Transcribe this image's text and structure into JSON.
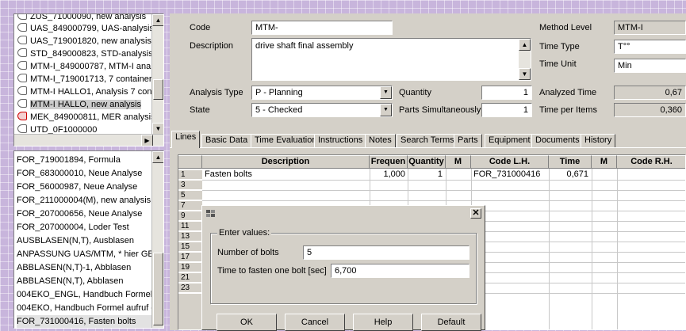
{
  "tree": {
    "items": [
      {
        "label": "ZUS_71000090, new analysis",
        "icon": "analysis-icon",
        "selected": false
      },
      {
        "label": "UAS_849000799, UAS-analysis",
        "icon": "analysis-icon",
        "selected": false
      },
      {
        "label": "UAS_719001820, new analysis",
        "icon": "analysis-icon",
        "selected": false
      },
      {
        "label": "STD_849000823, STD-analysis",
        "icon": "analysis-icon",
        "selected": false
      },
      {
        "label": "MTM-I_849000787, MTM-I analy",
        "icon": "analysis-icon",
        "selected": false
      },
      {
        "label": "MTM-I_719001713, 7 container",
        "icon": "analysis-icon",
        "selected": false
      },
      {
        "label": "MTM-I HALLO1, Analysis 7 con",
        "icon": "analysis-icon",
        "selected": false
      },
      {
        "label": "MTM-I HALLO, new analysis",
        "icon": "analysis-icon",
        "selected": true
      },
      {
        "label": "MEK_849000811, MER analysis",
        "icon": "analysis-red-icon",
        "selected": false
      },
      {
        "label": "UTD_0F1000000",
        "icon": "analysis-icon",
        "selected": false
      }
    ]
  },
  "formulas": {
    "items": [
      "FOR_719001894, Formula",
      "FOR_683000010, Neue Analyse",
      "FOR_56000987, Neue Analyse",
      "FOR_211000004(M), new analysis ar",
      "FOR_207000656, Neue Analyse",
      "FOR_207000004, Loder Test",
      "AUSBLASEN(N,T), Ausblasen",
      "ANPASSUNG UAS/MTM, * hier GES",
      "ABBLASEN(N,T)-1, Abblasen",
      "ABBLASEN(N,T), Abblasen",
      "004EKO_ENGL, Handbuch Formel a",
      "004EKO, Handbuch Formel aufruf de",
      "FOR_731000416, Fasten bolts"
    ],
    "selected_index": 12
  },
  "header": {
    "code_label": "Code",
    "code_value": "MTM-",
    "description_label": "Description",
    "description_value": "drive  shaft final assembly",
    "analysis_type_label": "Analysis Type",
    "analysis_type_value": "P - Planning",
    "state_label": "State",
    "state_value": "5 - Checked",
    "quantity_label": "Quantity",
    "quantity_value": "1",
    "parts_label": "Parts Simultaneously",
    "parts_value": "1",
    "method_level_label": "Method Level",
    "method_level_value": "MTM-I",
    "time_type_label": "Time Type",
    "time_type_value": "T°°",
    "time_unit_label": "Time Unit",
    "time_unit_value": "Min",
    "analyzed_time_label": "Analyzed Time",
    "analyzed_time_value": "0,67",
    "time_per_items_label": "Time per Items",
    "time_per_items_value": "0,360"
  },
  "tabs": [
    {
      "label": "Lines",
      "active": true
    },
    {
      "label": "Basic Data",
      "active": false
    },
    {
      "label": "Time Evaluation",
      "active": false
    },
    {
      "label": "Instructions",
      "active": false
    },
    {
      "label": "Notes",
      "active": false
    },
    {
      "label": "Search Terms",
      "active": false
    },
    {
      "label": "Parts",
      "active": false
    },
    {
      "label": "Equipment",
      "active": false
    },
    {
      "label": "Documents",
      "active": false
    },
    {
      "label": "History",
      "active": false
    }
  ],
  "grid": {
    "columns": [
      "Description",
      "Frequen",
      "Quantity",
      "M",
      "Code L.H.",
      "Time",
      "M",
      "Code R.H."
    ],
    "row_numbers": [
      "1",
      "3",
      "5",
      "7",
      "9",
      "11",
      "13",
      "15",
      "17",
      "19",
      "21",
      "23"
    ],
    "row1": {
      "description": "Fasten bolts",
      "frequency": "1,000",
      "quantity": "1",
      "code_lh": "FOR_731000416",
      "time": "0,671"
    }
  },
  "dialog": {
    "group_title": "Enter values:",
    "field1_label": "Number of bolts",
    "field1_value": "5",
    "field2_label": "Time to fasten one bolt [sec]",
    "field2_value": "6,700",
    "ok_label": "OK",
    "cancel_label": "Cancel",
    "help_label": "Help",
    "default_label": "Default"
  },
  "colors": {
    "selection": "#cccccc",
    "window": "#d4d0c8",
    "background": "#c8b5dc"
  }
}
